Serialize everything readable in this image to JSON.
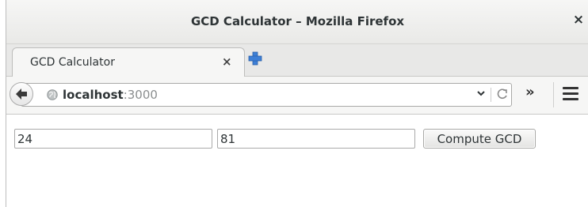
{
  "window": {
    "title": "GCD Calculator – Mozilla Firefox",
    "close_glyph": "×"
  },
  "tabs": [
    {
      "label": "GCD Calculator",
      "close_glyph": "×",
      "active": true
    }
  ],
  "navbar": {
    "url_host": "localhost",
    "url_port": ":3000",
    "dropdown_glyph": "▾",
    "reload_glyph": "C",
    "overflow_glyph": "»"
  },
  "form": {
    "first_value": "24",
    "second_value": "81",
    "submit_label": "Compute GCD"
  },
  "icons": {
    "back": "back-arrow-icon",
    "site": "globe-icon",
    "new_tab": "plus-icon",
    "menu": "hamburger-menu-icon"
  },
  "colors": {
    "new_tab_plus": "#3d7fd6",
    "title_text": "#2e3436",
    "port_text": "#8b8e8f"
  }
}
